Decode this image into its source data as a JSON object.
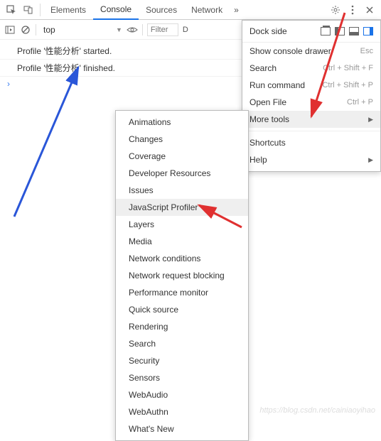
{
  "tabs": {
    "elements": "Elements",
    "console": "Console",
    "sources": "Sources",
    "network": "Network",
    "overflow": "»"
  },
  "toolbar": {
    "context": "top",
    "filter_placeholder": "Filter",
    "default_levels": "D"
  },
  "console_lines": {
    "l0": "Profile '性能分析' started.",
    "l1": "Profile '性能分析' finished."
  },
  "menu": {
    "dock": "Dock side",
    "show_drawer": "Show console drawer",
    "show_drawer_sc": "Esc",
    "search": "Search",
    "search_sc": "Ctrl + Shift + F",
    "run": "Run command",
    "run_sc": "Ctrl + Shift + P",
    "open": "Open File",
    "open_sc": "Ctrl + P",
    "more": "More tools",
    "shortcuts": "Shortcuts",
    "help": "Help",
    "arrow": "▶"
  },
  "tools": {
    "i0": "Animations",
    "i1": "Changes",
    "i2": "Coverage",
    "i3": "Developer Resources",
    "i4": "Issues",
    "i5": "JavaScript Profiler",
    "i6": "Layers",
    "i7": "Media",
    "i8": "Network conditions",
    "i9": "Network request blocking",
    "i10": "Performance monitor",
    "i11": "Quick source",
    "i12": "Rendering",
    "i13": "Search",
    "i14": "Security",
    "i15": "Sensors",
    "i16": "WebAudio",
    "i17": "WebAuthn",
    "i18": "What's New"
  },
  "watermark": "https://blog.csdn.net/cainiaoyihao"
}
